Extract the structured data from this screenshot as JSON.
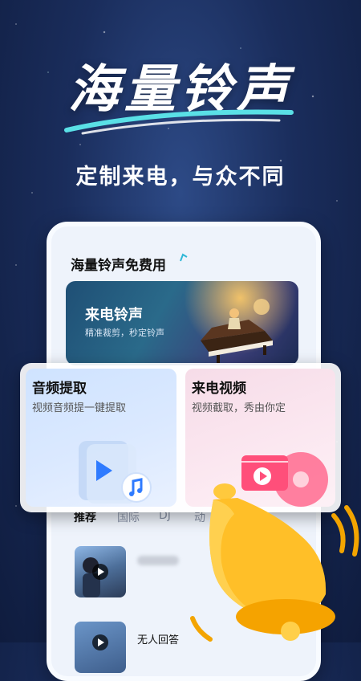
{
  "hero": {
    "title": "海量铃声",
    "subtitle": "定制来电，与众不同"
  },
  "phone": {
    "header_title": "海量铃声免费用",
    "banner": {
      "title": "来电铃声",
      "subtitle": "精准裁剪，秒定铃声"
    },
    "tabs": [
      "推荐",
      "国际",
      "DJ",
      "动"
    ],
    "active_tab": "推荐",
    "songs": [
      {
        "title": ""
      },
      {
        "title": "无人回答"
      }
    ]
  },
  "cards": {
    "audio": {
      "title": "音频提取",
      "subtitle": "视频音频提一键提取",
      "icon": "audio-file-icon"
    },
    "video": {
      "title": "来电视频",
      "subtitle": "视频截取，秀由你定",
      "icon": "video-record-icon"
    }
  },
  "colors": {
    "background": "#1a2d5c",
    "accent_blue": "#2f7bff",
    "accent_pink": "#ff4f7a",
    "bell": "#ffb300"
  }
}
